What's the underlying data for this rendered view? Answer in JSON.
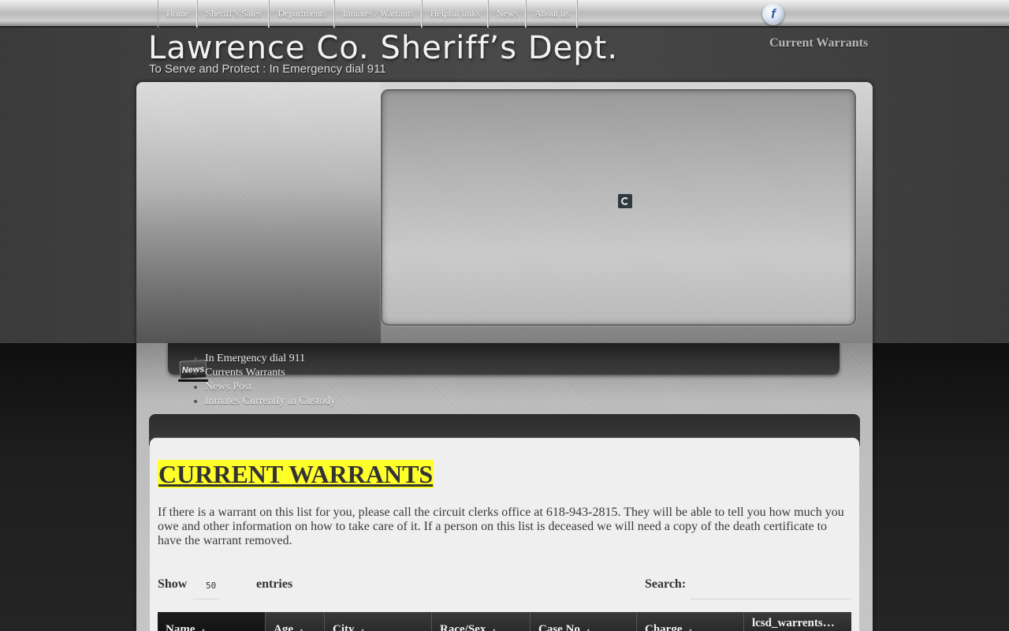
{
  "nav": {
    "items": [
      {
        "label": "Home"
      },
      {
        "label": "Sheriff’s Sales"
      },
      {
        "label": "Departments"
      },
      {
        "label": "Inmates / Warrants"
      },
      {
        "label": "Helpful links"
      },
      {
        "label": "News"
      },
      {
        "label": "About us"
      }
    ],
    "social_icon": "facebook-icon",
    "social_glyph": "f"
  },
  "header": {
    "title": "Lawrence Co. Sheriff’s Dept.",
    "tagline": "To Serve and Protect : In Emergency dial 911",
    "current_link": "Current Warrants"
  },
  "slider": {
    "loading_icon": "spinner-icon"
  },
  "news": {
    "icon_text": "News",
    "items": [
      {
        "label": "In Emergency dial 911"
      },
      {
        "label": "Currents Warrants"
      },
      {
        "label": "News Post"
      },
      {
        "label": "Inmates Currently in Custody"
      }
    ]
  },
  "content": {
    "title": "CURRENT WARRANTS",
    "body": "If there is a warrant on this list for you, please call the circuit clerks office at 618-943-2815.  They will be able to tell you how much you owe and other information on how to take care of it. If a person on this list is deceased we will need a copy of the death certificate to have the warrant removed."
  },
  "table": {
    "show_label": "Show",
    "page_length": "50",
    "entries_label": "entries",
    "search_label": "Search:",
    "search_value": "",
    "columns": [
      {
        "label": "Name"
      },
      {
        "label": "Age"
      },
      {
        "label": "City"
      },
      {
        "label": "Race/Sex"
      },
      {
        "label": "Case No"
      },
      {
        "label": "Charge"
      },
      {
        "label": "lcsd_warrents…"
      }
    ]
  },
  "colors": {
    "title_highlight": "#ffff2a",
    "table_header": "#2c2c2c"
  }
}
